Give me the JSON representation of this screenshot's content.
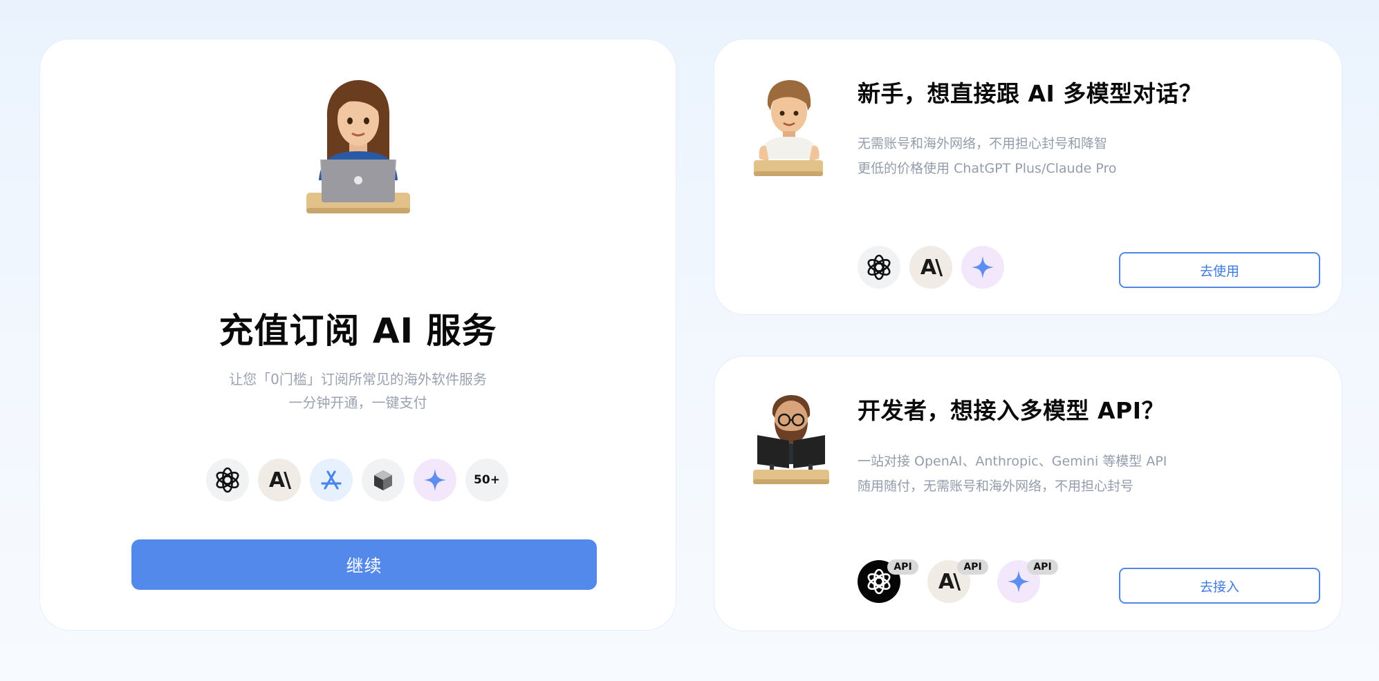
{
  "left_card": {
    "title": "充值订阅 AI 服务",
    "subtitle_line1": "让您「0门槛」订阅所常见的海外软件服务",
    "subtitle_line2": "一分钟开通，一键支付",
    "icons": [
      "openai-icon",
      "anthropic-icon",
      "app-store-icon",
      "cube-icon",
      "gemini-icon",
      "50+"
    ],
    "more_label": "50+",
    "continue_label": "继续",
    "button_color": "#5289ea"
  },
  "top_card": {
    "title": "新手，想直接跟 AI 多模型对话？",
    "desc_line1": "无需账号和海外网络，不用担心封号和降智",
    "desc_line2": "更低的价格使用 ChatGPT Plus/Claude Pro",
    "icons": [
      "openai-icon",
      "anthropic-icon",
      "gemini-icon"
    ],
    "button_label": "去使用"
  },
  "bottom_card": {
    "title": "开发者，想接入多模型 API？",
    "desc_line1": "一站对接 OpenAI、Anthropic、Gemini 等模型 API",
    "desc_line2": "随用随付，无需账号和海外网络，不用担心封号",
    "icons": [
      "openai-icon",
      "anthropic-icon",
      "gemini-icon"
    ],
    "api_badge": "API",
    "button_label": "去接入"
  },
  "colors": {
    "accent": "#4f86e6",
    "muted_text": "#939cab"
  }
}
